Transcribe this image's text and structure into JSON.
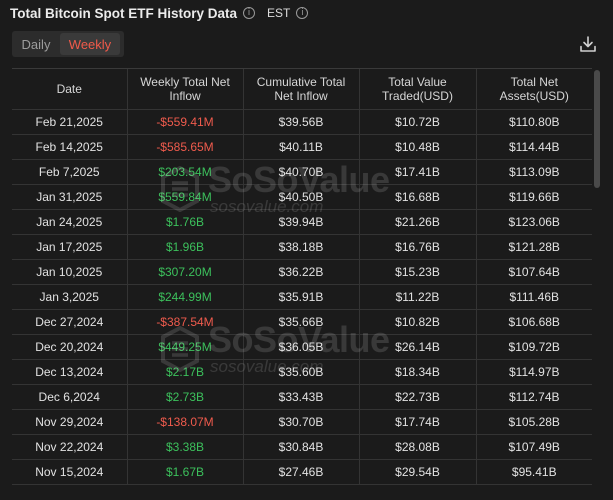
{
  "header": {
    "title": "Total Bitcoin Spot ETF History Data",
    "timezone": "EST"
  },
  "toggle": {
    "daily": "Daily",
    "weekly": "Weekly",
    "selected": "Weekly"
  },
  "colors": {
    "accent": "#f05a4a",
    "negative": "#ef5b4d",
    "positive": "#3cc05c",
    "background": "#1b1b1b"
  },
  "table": {
    "columns": [
      "Date",
      "Weekly Total Net Inflow",
      "Cumulative Total Net Inflow",
      "Total Value Traded(USD)",
      "Total Net Assets(USD)"
    ],
    "rows": [
      {
        "date": "Feb 21,2025",
        "weekly": "-$559.41M",
        "sign": "neg",
        "cumulative": "$39.56B",
        "traded": "$10.72B",
        "assets": "$110.80B"
      },
      {
        "date": "Feb 14,2025",
        "weekly": "-$585.65M",
        "sign": "neg",
        "cumulative": "$40.11B",
        "traded": "$10.48B",
        "assets": "$114.44B"
      },
      {
        "date": "Feb 7,2025",
        "weekly": "$203.54M",
        "sign": "pos",
        "cumulative": "$40.70B",
        "traded": "$17.41B",
        "assets": "$113.09B"
      },
      {
        "date": "Jan 31,2025",
        "weekly": "$559.84M",
        "sign": "pos",
        "cumulative": "$40.50B",
        "traded": "$16.68B",
        "assets": "$119.66B"
      },
      {
        "date": "Jan 24,2025",
        "weekly": "$1.76B",
        "sign": "pos",
        "cumulative": "$39.94B",
        "traded": "$21.26B",
        "assets": "$123.06B"
      },
      {
        "date": "Jan 17,2025",
        "weekly": "$1.96B",
        "sign": "pos",
        "cumulative": "$38.18B",
        "traded": "$16.76B",
        "assets": "$121.28B"
      },
      {
        "date": "Jan 10,2025",
        "weekly": "$307.20M",
        "sign": "pos",
        "cumulative": "$36.22B",
        "traded": "$15.23B",
        "assets": "$107.64B"
      },
      {
        "date": "Jan 3,2025",
        "weekly": "$244.99M",
        "sign": "pos",
        "cumulative": "$35.91B",
        "traded": "$11.22B",
        "assets": "$111.46B"
      },
      {
        "date": "Dec 27,2024",
        "weekly": "-$387.54M",
        "sign": "neg",
        "cumulative": "$35.66B",
        "traded": "$10.82B",
        "assets": "$106.68B"
      },
      {
        "date": "Dec 20,2024",
        "weekly": "$449.25M",
        "sign": "pos",
        "cumulative": "$36.05B",
        "traded": "$26.14B",
        "assets": "$109.72B"
      },
      {
        "date": "Dec 13,2024",
        "weekly": "$2.17B",
        "sign": "pos",
        "cumulative": "$35.60B",
        "traded": "$18.34B",
        "assets": "$114.97B"
      },
      {
        "date": "Dec 6,2024",
        "weekly": "$2.73B",
        "sign": "pos",
        "cumulative": "$33.43B",
        "traded": "$22.73B",
        "assets": "$112.74B"
      },
      {
        "date": "Nov 29,2024",
        "weekly": "-$138.07M",
        "sign": "neg",
        "cumulative": "$30.70B",
        "traded": "$17.74B",
        "assets": "$105.28B"
      },
      {
        "date": "Nov 22,2024",
        "weekly": "$3.38B",
        "sign": "pos",
        "cumulative": "$30.84B",
        "traded": "$28.08B",
        "assets": "$107.49B"
      },
      {
        "date": "Nov 15,2024",
        "weekly": "$1.67B",
        "sign": "pos",
        "cumulative": "$27.46B",
        "traded": "$29.54B",
        "assets": "$95.41B"
      }
    ]
  },
  "watermark": {
    "brand": "SoSoValue",
    "site": "sosovalue.com"
  },
  "icons": {
    "info": "info-icon",
    "download": "download-icon"
  }
}
